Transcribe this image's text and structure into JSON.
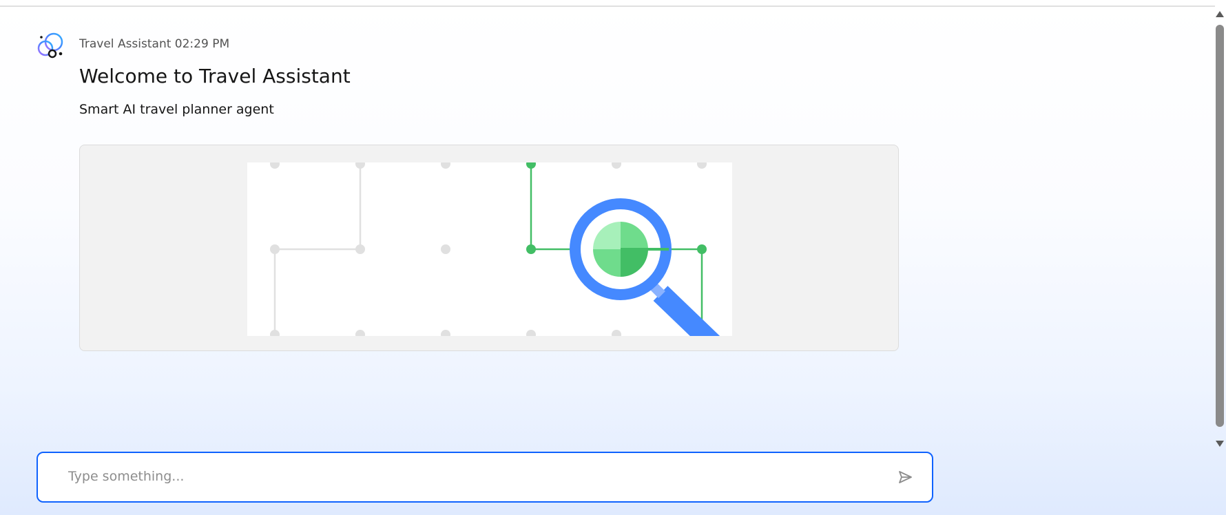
{
  "message": {
    "sender": "Travel Assistant",
    "time": "02:29 PM",
    "title": "Welcome to Travel Assistant",
    "subtitle": "Smart AI travel planner agent"
  },
  "illustration": {
    "icon": "magnifier-network-icon"
  },
  "composer": {
    "placeholder": "Type something...",
    "value": "",
    "send_icon": "send-icon"
  },
  "colors": {
    "accent_blue": "#0f62fe",
    "magnifier_blue": "#4589ff",
    "network_green": "#42be65",
    "light_green": "#6fdc8c",
    "pale_green": "#a7f0ba",
    "grid_gray": "#e0e0e0",
    "card_bg": "#f2f2f2"
  }
}
